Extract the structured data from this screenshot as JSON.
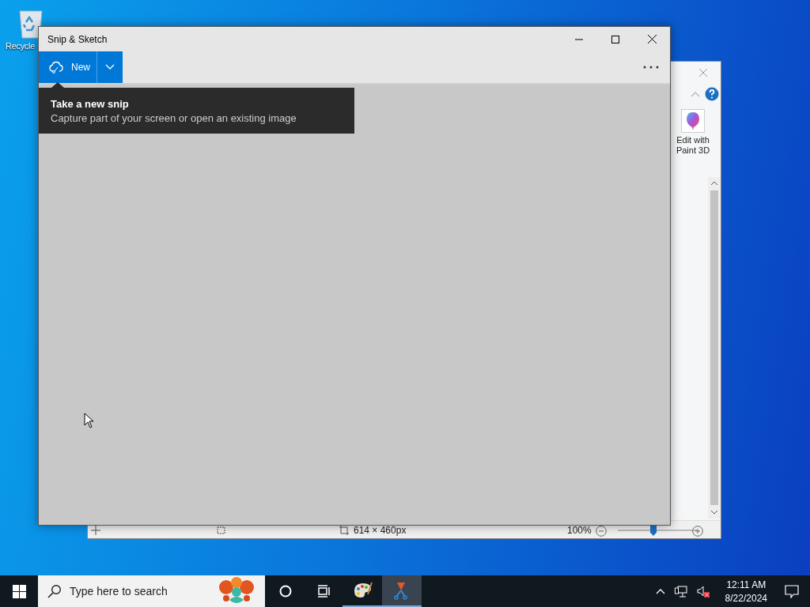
{
  "desktop": {
    "icons": [
      {
        "label": "Recycle"
      }
    ]
  },
  "background_window": {
    "ribbon_buttons": [
      {
        "label": "Edit with Paint 3D"
      }
    ],
    "status_bar": {
      "dimensions": "614 × 460px",
      "zoom": "100%",
      "zoom_slider": {
        "level": 0.45
      }
    }
  },
  "snip_window": {
    "title": "Snip & Sketch",
    "new_button": {
      "label": "New"
    },
    "tooltip": {
      "title": "Take a new snip",
      "description": "Capture part of your screen or open an existing image"
    }
  },
  "taskbar": {
    "search": {
      "placeholder": "Type here to search"
    },
    "apps": [
      {
        "kind": "paint",
        "selected": false
      },
      {
        "kind": "snip",
        "selected": true
      }
    ],
    "clock": {
      "time": "12:11 AM",
      "date": "8/22/2024"
    }
  }
}
